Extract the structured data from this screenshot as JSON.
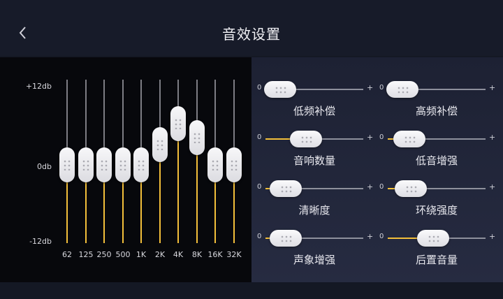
{
  "header": {
    "title": "音效设置",
    "back_icon": "chevron-left-icon"
  },
  "equalizer": {
    "db_labels": {
      "max": "+12db",
      "mid": "0db",
      "min": "-12db"
    },
    "bands": [
      {
        "freq": "62",
        "gain_db": 0
      },
      {
        "freq": "125",
        "gain_db": 0
      },
      {
        "freq": "250",
        "gain_db": 0
      },
      {
        "freq": "500",
        "gain_db": 0
      },
      {
        "freq": "1K",
        "gain_db": 0
      },
      {
        "freq": "2K",
        "gain_db": 3
      },
      {
        "freq": "4K",
        "gain_db": 6
      },
      {
        "freq": "8K",
        "gain_db": 4
      },
      {
        "freq": "16K",
        "gain_db": 0
      },
      {
        "freq": "32K",
        "gain_db": 0
      }
    ]
  },
  "effects": [
    {
      "label": "低频补偿",
      "min": "0",
      "max": "+",
      "value": 0.0
    },
    {
      "label": "高频补偿",
      "min": "0",
      "max": "+",
      "value": 0.0
    },
    {
      "label": "音响数量",
      "min": "0",
      "max": "+",
      "value": 0.38
    },
    {
      "label": "低音增强",
      "min": "0",
      "max": "+",
      "value": 0.1
    },
    {
      "label": "清晰度",
      "min": "0",
      "max": "+",
      "value": 0.08
    },
    {
      "label": "环绕强度",
      "min": "0",
      "max": "+",
      "value": 0.12
    },
    {
      "label": "声象增强",
      "min": "0",
      "max": "+",
      "value": 0.08
    },
    {
      "label": "后置音量",
      "min": "0",
      "max": "+",
      "value": 0.45
    }
  ],
  "colors": {
    "accent": "#f3bf3a",
    "track": "#7d7d84",
    "knob": "#f2f2f5"
  }
}
